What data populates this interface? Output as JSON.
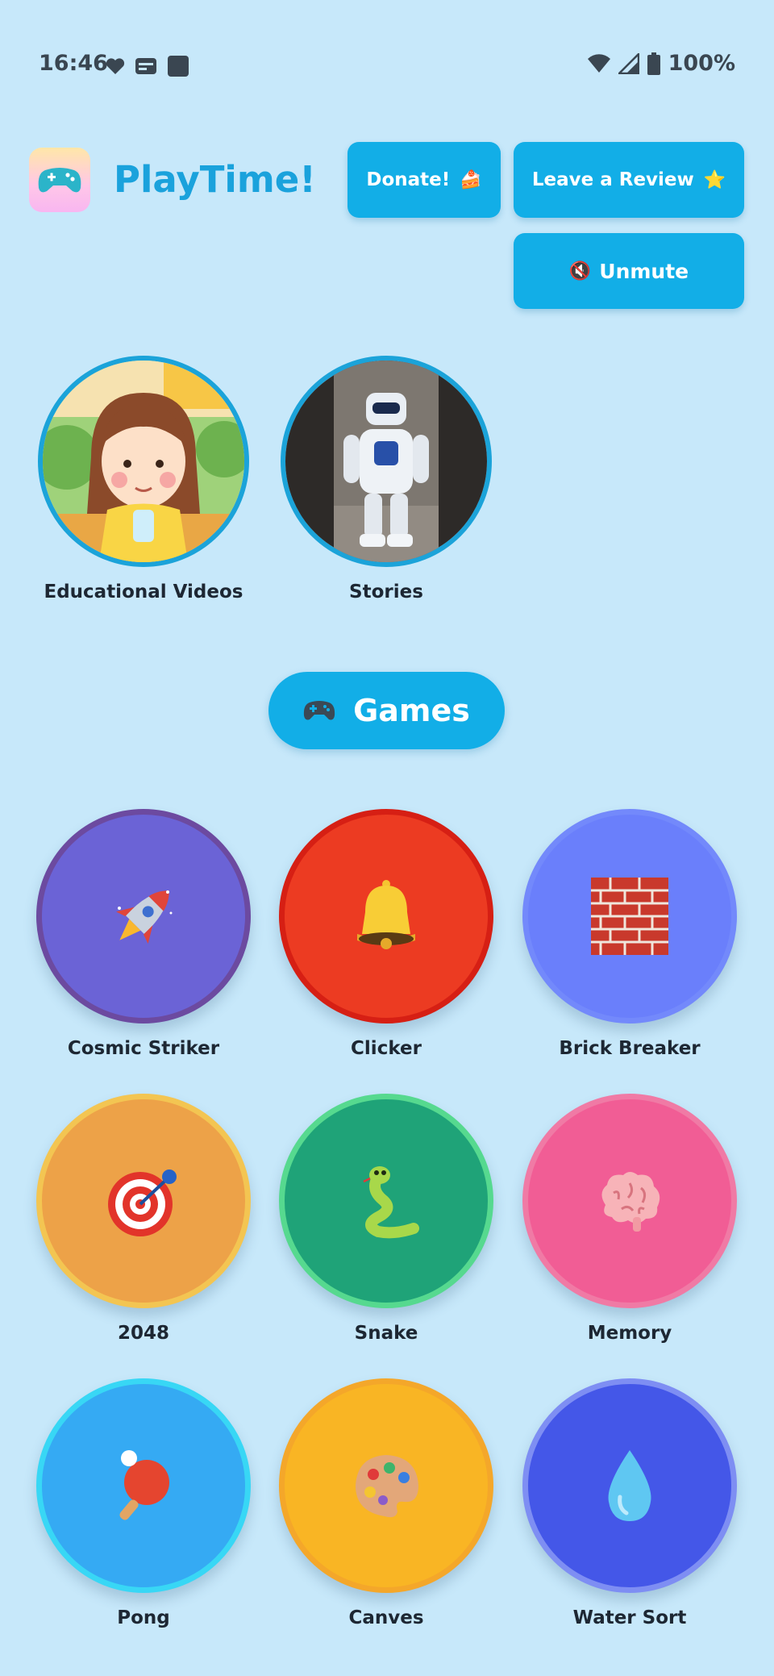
{
  "status_bar": {
    "time": "16:46",
    "battery": "100%",
    "left_icons": [
      "heart-notification-icon",
      "card-notification-icon",
      "square-notification-icon"
    ],
    "right_icons": [
      "wifi-icon",
      "signal-icon",
      "battery-icon"
    ]
  },
  "header": {
    "app_name": "PlayTime!",
    "logo_icon": "gamepad-icon",
    "donate_label": "Donate!",
    "donate_emoji": "🍰",
    "review_label": "Leave a Review",
    "review_emoji": "⭐",
    "unmute_label": "Unmute",
    "unmute_emoji": "🔇"
  },
  "media": [
    {
      "label": "Educational Videos",
      "image": "girl-illustration"
    },
    {
      "label": "Stories",
      "image": "robot-photo"
    }
  ],
  "games_section": {
    "title": "Games",
    "icon": "gamepad-icon"
  },
  "games": [
    {
      "label": "Cosmic Striker",
      "icon": "rocket-icon",
      "fill": "#6b63d6",
      "border": "#6c4aa0"
    },
    {
      "label": "Clicker",
      "icon": "bell-icon",
      "fill": "#ec3b22",
      "border": "#d61f14"
    },
    {
      "label": "Brick Breaker",
      "icon": "brick-wall-icon",
      "fill": "#6a7ffb",
      "border": "#7389fb"
    },
    {
      "label": "2048",
      "icon": "target-icon",
      "fill": "#eda248",
      "border": "#f3c552"
    },
    {
      "label": "Snake",
      "icon": "snake-icon",
      "fill": "#1fa378",
      "border": "#56d98f"
    },
    {
      "label": "Memory",
      "icon": "brain-icon",
      "fill": "#f15d95",
      "border": "#f07aa5"
    },
    {
      "label": "Pong",
      "icon": "ping-pong-icon",
      "fill": "#35aaf3",
      "border": "#38d7f5"
    },
    {
      "label": "Canves",
      "icon": "palette-icon",
      "fill": "#f9b524",
      "border": "#f4a72a"
    },
    {
      "label": "Water Sort",
      "icon": "water-drop-icon",
      "fill": "#4457e8",
      "border": "#7e8ef3"
    }
  ]
}
